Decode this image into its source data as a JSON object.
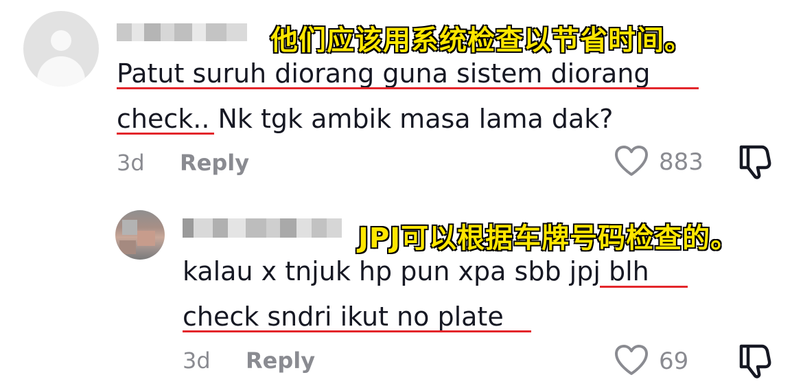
{
  "comments": [
    {
      "caption": "他们应该用系统检查以节省时间。",
      "text_line1": "Patut suruh diorang guna sistem diorang",
      "text_line2": "check.. Nk tgk ambik masa lama dak?",
      "age": "3d",
      "reply_label": "Reply",
      "likes": "883"
    },
    {
      "caption": "JPJ可以根据车牌号码检查的。",
      "text_line1": "kalau x tnjuk hp pun xpa sbb jpj blh",
      "text_line2": "check sndri ikut no plate",
      "age": "3d",
      "reply_label": "Reply",
      "likes": "69"
    }
  ],
  "colors": {
    "caption": "#ffe600",
    "underline": "#e3262b",
    "muted": "#8a8b91",
    "text": "#161823"
  },
  "icons": [
    "default-avatar-icon",
    "heart-icon",
    "dislike-thumb-icon"
  ]
}
